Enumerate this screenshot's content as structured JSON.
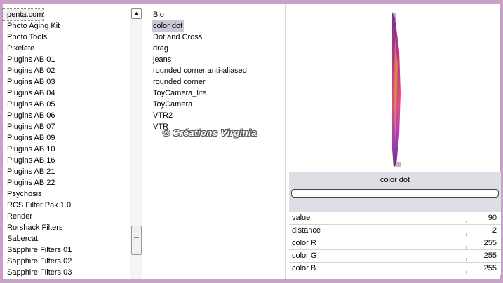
{
  "filters": [
    "penta.com",
    "Photo Aging Kit",
    "Photo Tools",
    "Pixelate",
    "Plugins AB 01",
    "Plugins AB 02",
    "Plugins AB 03",
    "Plugins AB 04",
    "Plugins AB 05",
    "Plugins AB 06",
    "Plugins AB 07",
    "Plugins AB 09",
    "Plugins AB 10",
    "Plugins AB 16",
    "Plugins AB 21",
    "Plugins AB 22",
    "Psychosis",
    "RCS Filter Pak 1.0",
    "Render",
    "Rorshack Filters",
    "Sabercat",
    "Sapphire Filters 01",
    "Sapphire Filters 02",
    "Sapphire Filters 03"
  ],
  "effects": [
    "Bio",
    "color dot",
    "Dot and Cross",
    "drag",
    "jeans",
    "rounded corner anti-aliased",
    "rounded corner",
    "ToyCamera_lite",
    "ToyCamera",
    "VTR2",
    "VTR"
  ],
  "watermark": "© Créations Virginia",
  "selected_effect": "color dot",
  "params": [
    {
      "name": "value",
      "value": "90"
    },
    {
      "name": "distance",
      "value": "2"
    },
    {
      "name": "color R",
      "value": "255"
    },
    {
      "name": "color G",
      "value": "255"
    },
    {
      "name": "color B",
      "value": "255"
    }
  ],
  "colors": {
    "frame": "#c8a0c8",
    "selection": "#c8c8d8"
  }
}
